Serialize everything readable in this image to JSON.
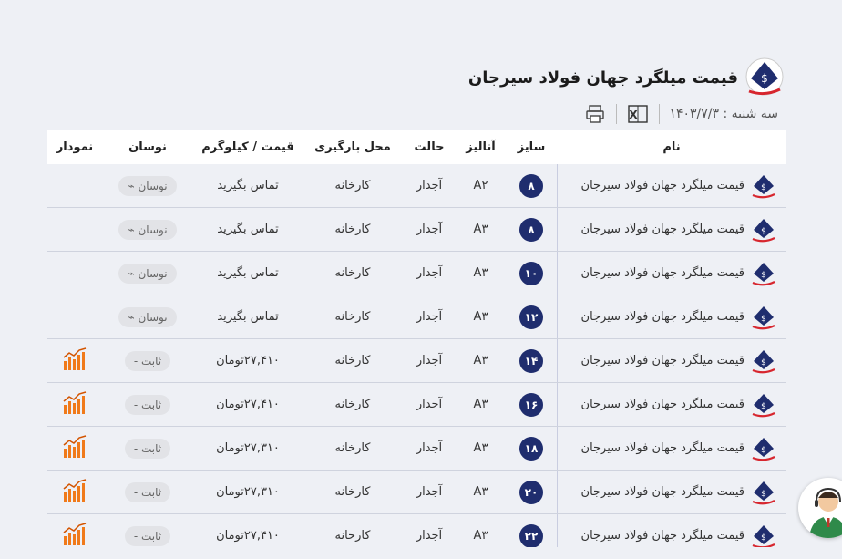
{
  "page": {
    "title": "قیمت میلگرد جهان فولاد سیرجان",
    "date_label": "سه شنبه : ۱۴۰۳/۷/۳"
  },
  "colors": {
    "accent": "#1f2d6e",
    "chart_orange": "#f07a1a",
    "logo_red": "#d7262e"
  },
  "icons": {
    "print": "printer-icon",
    "excel": "excel-icon",
    "chart": "bar-chart-icon",
    "support": "support-agent-icon"
  },
  "table": {
    "headers": {
      "name": "نام",
      "size": "سایز",
      "analysis": "آنالیز",
      "state": "حالت",
      "place": "محل بارگیری",
      "price": "قیمت / کیلوگرم",
      "fluct": "نوسان",
      "chart": "نمودار"
    },
    "rows": [
      {
        "name": "قیمت میلگرد جهان فولاد سیرجان",
        "size": "۸",
        "analysis": "A۲",
        "state": "آجدار",
        "place": "کارخانه",
        "price": "تماس بگیرید",
        "fluct": "نوسان ⌁",
        "chart": false
      },
      {
        "name": "قیمت میلگرد جهان فولاد سیرجان",
        "size": "۸",
        "analysis": "A۳",
        "state": "آجدار",
        "place": "کارخانه",
        "price": "تماس بگیرید",
        "fluct": "نوسان ⌁",
        "chart": false
      },
      {
        "name": "قیمت میلگرد جهان فولاد سیرجان",
        "size": "۱۰",
        "analysis": "A۳",
        "state": "آجدار",
        "place": "کارخانه",
        "price": "تماس بگیرید",
        "fluct": "نوسان ⌁",
        "chart": false
      },
      {
        "name": "قیمت میلگرد جهان فولاد سیرجان",
        "size": "۱۲",
        "analysis": "A۳",
        "state": "آجدار",
        "place": "کارخانه",
        "price": "تماس بگیرید",
        "fluct": "نوسان ⌁",
        "chart": false
      },
      {
        "name": "قیمت میلگرد جهان فولاد سیرجان",
        "size": "۱۴",
        "analysis": "A۳",
        "state": "آجدار",
        "place": "کارخانه",
        "price": "۲۷,۴۱۰تومان",
        "fluct": "ثابت -",
        "chart": true
      },
      {
        "name": "قیمت میلگرد جهان فولاد سیرجان",
        "size": "۱۶",
        "analysis": "A۳",
        "state": "آجدار",
        "place": "کارخانه",
        "price": "۲۷,۴۱۰تومان",
        "fluct": "ثابت -",
        "chart": true
      },
      {
        "name": "قیمت میلگرد جهان فولاد سیرجان",
        "size": "۱۸",
        "analysis": "A۳",
        "state": "آجدار",
        "place": "کارخانه",
        "price": "۲۷,۳۱۰تومان",
        "fluct": "ثابت -",
        "chart": true
      },
      {
        "name": "قیمت میلگرد جهان فولاد سیرجان",
        "size": "۲۰",
        "analysis": "A۳",
        "state": "آجدار",
        "place": "کارخانه",
        "price": "۲۷,۳۱۰تومان",
        "fluct": "ثابت -",
        "chart": true
      },
      {
        "name": "قیمت میلگرد جهان فولاد سیرجان",
        "size": "۲۲",
        "analysis": "A۳",
        "state": "آجدار",
        "place": "کارخانه",
        "price": "۲۷,۴۱۰تومان",
        "fluct": "ثابت -",
        "chart": true
      }
    ]
  }
}
